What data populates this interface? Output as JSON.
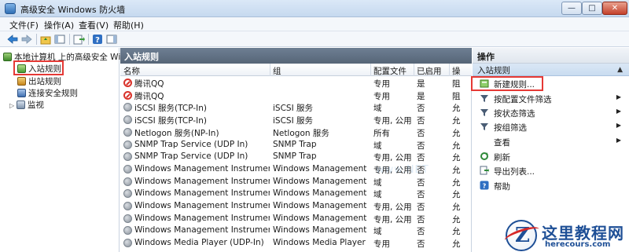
{
  "window": {
    "title": "高级安全 Windows 防火墙",
    "min_symbol": "—",
    "max_symbol": "□",
    "close_symbol": "✕"
  },
  "menu": [
    "文件(F)",
    "操作(A)",
    "查看(V)",
    "帮助(H)"
  ],
  "toolbar": {
    "icons": [
      "back-arrow-icon",
      "forward-arrow-icon",
      "up-folder-icon",
      "show-tree-icon",
      "export-icon",
      "help-icon",
      "show-pane-icon"
    ]
  },
  "tree": {
    "root": "本地计算机 上的高级安全 Win",
    "items": [
      {
        "label": "入站规则",
        "icon": "inbound-rules-icon"
      },
      {
        "label": "出站规则",
        "icon": "outbound-rules-icon"
      },
      {
        "label": "连接安全规则",
        "icon": "connection-security-icon"
      },
      {
        "label": "监视",
        "icon": "monitor-icon",
        "expander": "▷"
      }
    ]
  },
  "middle": {
    "title": "入站规则",
    "columns": [
      "名称",
      "组",
      "配置文件",
      "已启用",
      "操"
    ],
    "rows": [
      {
        "name": "腾讯QQ",
        "group": "",
        "profile": "专用",
        "enabled": "是",
        "action": "阻",
        "status": "block"
      },
      {
        "name": "腾讯QQ",
        "group": "",
        "profile": "专用",
        "enabled": "是",
        "action": "阻",
        "status": "block"
      },
      {
        "name": "iSCSI 服务(TCP-In)",
        "group": "iSCSI 服务",
        "profile": "域",
        "enabled": "否",
        "action": "允",
        "status": "allow"
      },
      {
        "name": "iSCSI 服务(TCP-In)",
        "group": "iSCSI 服务",
        "profile": "专用, 公用",
        "enabled": "否",
        "action": "允",
        "status": "allow"
      },
      {
        "name": "Netlogon 服务(NP-In)",
        "group": "Netlogon 服务",
        "profile": "所有",
        "enabled": "否",
        "action": "允",
        "status": "allow"
      },
      {
        "name": "SNMP Trap Service (UDP In)",
        "group": "SNMP Trap",
        "profile": "域",
        "enabled": "否",
        "action": "允",
        "status": "allow"
      },
      {
        "name": "SNMP Trap Service (UDP In)",
        "group": "SNMP Trap",
        "profile": "专用, 公用",
        "enabled": "否",
        "action": "允",
        "status": "allow"
      },
      {
        "name": "Windows Management Instrumentati...",
        "group": "Windows Management In...",
        "profile": "专用, 公用",
        "enabled": "否",
        "action": "允",
        "status": "allow"
      },
      {
        "name": "Windows Management Instrumentati...",
        "group": "Windows Management In...",
        "profile": "域",
        "enabled": "否",
        "action": "允",
        "status": "allow"
      },
      {
        "name": "Windows Management Instrumentati...",
        "group": "Windows Management In...",
        "profile": "域",
        "enabled": "否",
        "action": "允",
        "status": "allow"
      },
      {
        "name": "Windows Management Instrumentati...",
        "group": "Windows Management In...",
        "profile": "专用, 公用",
        "enabled": "否",
        "action": "允",
        "status": "allow"
      },
      {
        "name": "Windows Management Instrumentati...",
        "group": "Windows Management In...",
        "profile": "专用, 公用",
        "enabled": "否",
        "action": "允",
        "status": "allow"
      },
      {
        "name": "Windows Management Instrumentati...",
        "group": "Windows Management In...",
        "profile": "域",
        "enabled": "否",
        "action": "允",
        "status": "allow"
      },
      {
        "name": "Windows Media Player (UDP-In)",
        "group": "Windows Media Player",
        "profile": "专用",
        "enabled": "否",
        "action": "允",
        "status": "allow"
      }
    ]
  },
  "actions": {
    "title": "操作",
    "section": "入站规则",
    "collapse_symbol": "▲",
    "items": [
      {
        "label": "新建规则...",
        "icon": "new-rule-icon",
        "submenu": false
      },
      {
        "label": "按配置文件筛选",
        "icon": "filter-icon",
        "submenu": true
      },
      {
        "label": "按状态筛选",
        "icon": "filter-icon",
        "submenu": true
      },
      {
        "label": "按组筛选",
        "icon": "filter-icon",
        "submenu": true
      },
      {
        "label": "查看",
        "icon": "",
        "submenu": true
      },
      {
        "label": "刷新",
        "icon": "refresh-icon",
        "submenu": false
      },
      {
        "label": "导出列表...",
        "icon": "export-list-icon",
        "submenu": false
      },
      {
        "label": "帮助",
        "icon": "help-icon",
        "submenu": false
      }
    ]
  },
  "logo": {
    "brand": "这里教程网",
    "domain": "herecours.com",
    "letter": "Z"
  }
}
